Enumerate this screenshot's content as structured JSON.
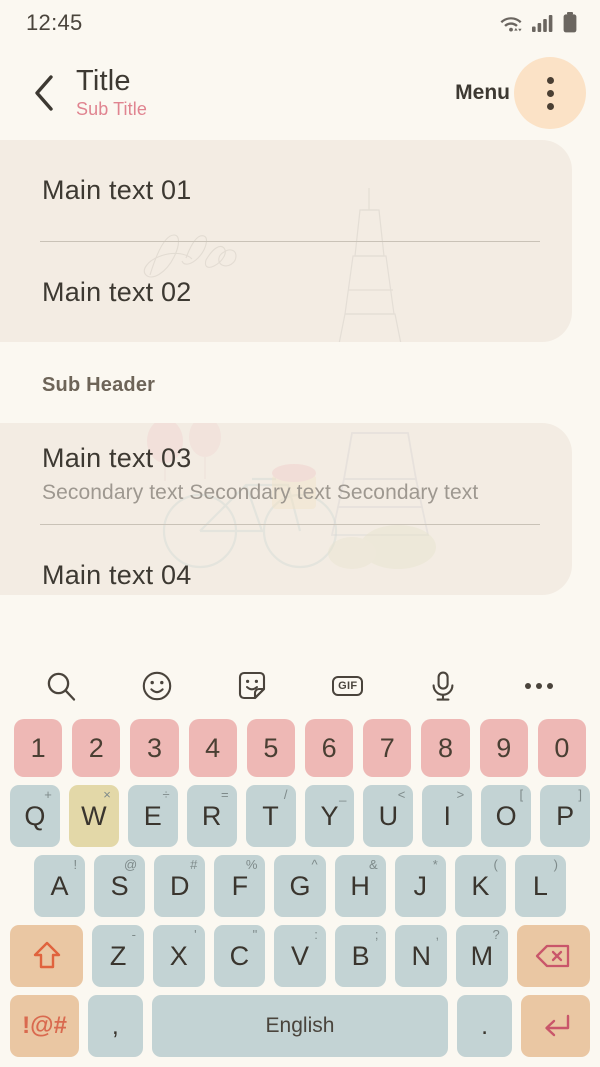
{
  "status_bar": {
    "time": "12:45",
    "icons": [
      "wifi-icon",
      "cellular-signal-icon",
      "battery-icon"
    ]
  },
  "app_bar": {
    "back_icon": "chevron-left-icon",
    "title": "Title",
    "subtitle": "Sub Title",
    "menu_label": "Menu",
    "overflow_icon": "more-vertical-icon",
    "accent_color": "#fbe2c6",
    "subtitle_color": "#e08490"
  },
  "list": {
    "card_color": "#f3ece3",
    "group_one": [
      {
        "main": "Main text 01"
      },
      {
        "main": "Main text 02"
      }
    ],
    "sub_header": "Sub Header",
    "group_two": [
      {
        "main": "Main text 03",
        "secondary": "Secondary text Secondary text Secondary text"
      },
      {
        "main": "Main text 04"
      }
    ]
  },
  "keyboard": {
    "toolbar": [
      {
        "name": "search-icon",
        "label": ""
      },
      {
        "name": "emoji-icon",
        "label": ""
      },
      {
        "name": "sticker-icon",
        "label": ""
      },
      {
        "name": "gif-icon",
        "label": "GIF"
      },
      {
        "name": "microphone-icon",
        "label": ""
      },
      {
        "name": "more-horizontal-icon",
        "label": ""
      }
    ],
    "numbers": [
      "1",
      "2",
      "3",
      "4",
      "5",
      "6",
      "7",
      "8",
      "9",
      "0"
    ],
    "row_q": [
      {
        "key": "Q",
        "sup": "+"
      },
      {
        "key": "W",
        "sup": "×",
        "active": true
      },
      {
        "key": "E",
        "sup": "÷"
      },
      {
        "key": "R",
        "sup": "="
      },
      {
        "key": "T",
        "sup": "/"
      },
      {
        "key": "Y",
        "sup": "_"
      },
      {
        "key": "U",
        "sup": "<"
      },
      {
        "key": "I",
        "sup": ">"
      },
      {
        "key": "O",
        "sup": "["
      },
      {
        "key": "P",
        "sup": "]"
      }
    ],
    "row_a": [
      {
        "key": "A",
        "sup": "!"
      },
      {
        "key": "S",
        "sup": "@"
      },
      {
        "key": "D",
        "sup": "#"
      },
      {
        "key": "F",
        "sup": "%"
      },
      {
        "key": "G",
        "sup": "^"
      },
      {
        "key": "H",
        "sup": "&"
      },
      {
        "key": "J",
        "sup": "*"
      },
      {
        "key": "K",
        "sup": "("
      },
      {
        "key": "L",
        "sup": ")"
      }
    ],
    "row_z": [
      {
        "key": "Z",
        "sup": "-"
      },
      {
        "key": "X",
        "sup": "'"
      },
      {
        "key": "C",
        "sup": "\""
      },
      {
        "key": "V",
        "sup": ":"
      },
      {
        "key": "B",
        "sup": ";"
      },
      {
        "key": "N",
        "sup": ","
      },
      {
        "key": "M",
        "sup": "?"
      }
    ],
    "shift_icon": "shift-up-arrow-icon",
    "backspace_icon": "backspace-delete-icon",
    "symbols_label": "!@#",
    "comma_label": ",",
    "space_label": "English",
    "period_label": ".",
    "enter_icon": "enter-return-icon",
    "key_color": "#c3d3d4",
    "number_key_color": "#eeb8b5",
    "function_key_color": "#eac7a3",
    "active_key_color": "#e3d8a8"
  }
}
